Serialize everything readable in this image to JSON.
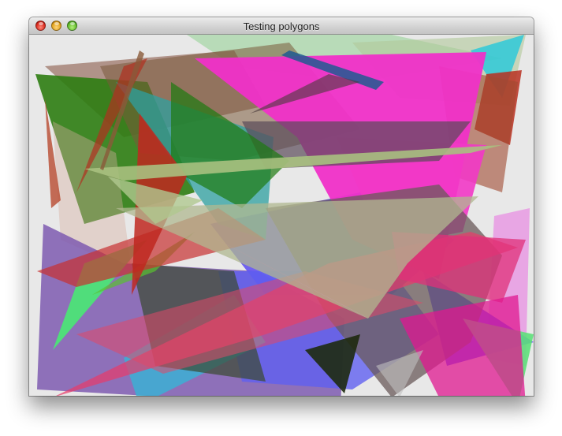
{
  "window": {
    "title": "Testing polygons"
  },
  "controls": {
    "close": "close-button",
    "minimize": "minimize-button",
    "zoom": "zoom-button"
  },
  "canvas": {
    "background": "#e8e8e8"
  }
}
